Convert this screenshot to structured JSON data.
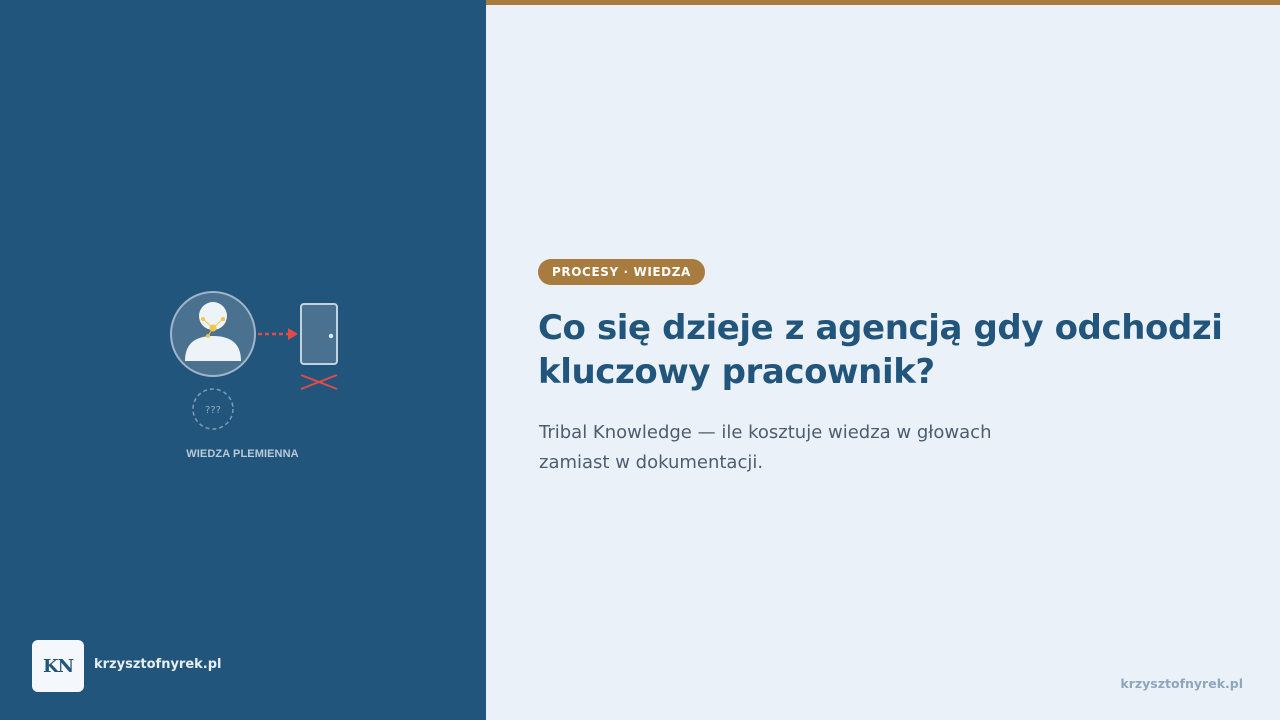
{
  "colors": {
    "left_panel": "#22557b",
    "background": "#ebf1f8",
    "accent": "#a87b3e",
    "title": "#22557b",
    "subtitle": "#4d5d70",
    "arrow": "#e04b4b"
  },
  "illustration": {
    "icons": [
      "person-icon",
      "door-icon",
      "arrow-icon",
      "cross-icon",
      "question-circle-icon"
    ],
    "question_marks": "???",
    "caption": "WIEDZA PLEMIENNA"
  },
  "logo": {
    "initials": "KN"
  },
  "left_footer": {
    "domain": "krzysztofnyrek.pl"
  },
  "badge": {
    "label": "PROCESY · WIEDZA"
  },
  "title": "Co się dzieje z agencją gdy odchodzi kluczowy pracownik?",
  "subtitle": "Tribal Knowledge — ile kosztuje wiedza w głowach zamiast w dokumentacji.",
  "right_footer": {
    "domain": "krzysztofnyrek.pl"
  }
}
